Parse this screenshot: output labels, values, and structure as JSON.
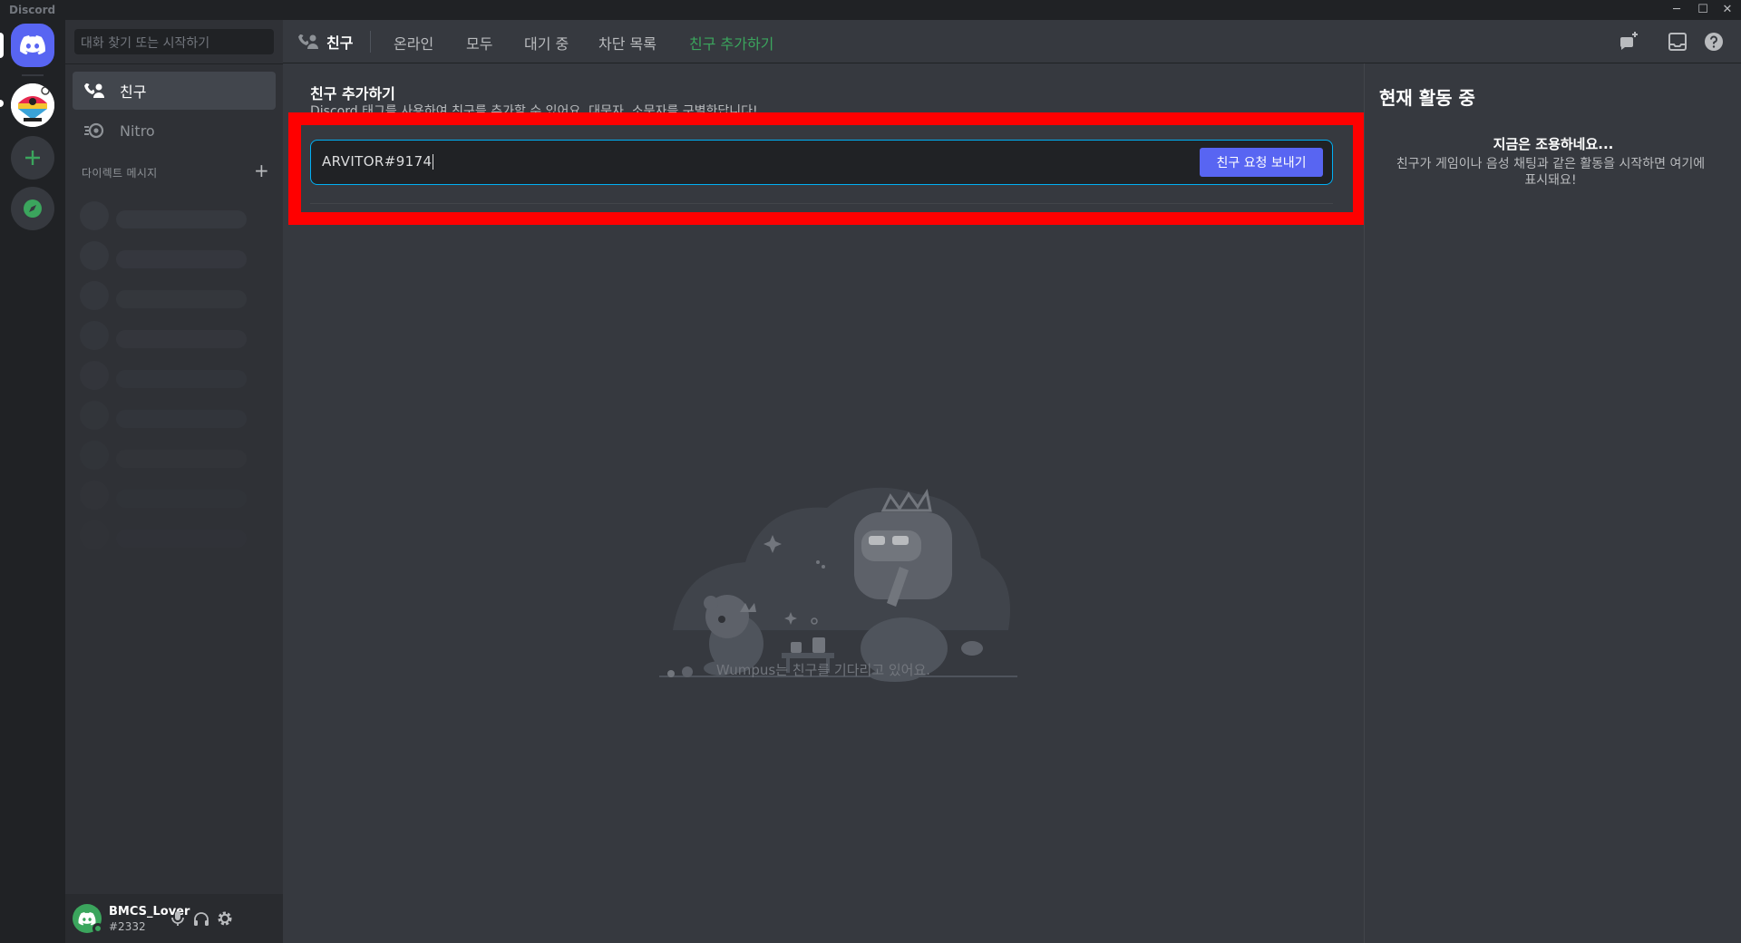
{
  "window": {
    "title": "Discord",
    "minimize": "─",
    "maximize": "☐",
    "close": "✕"
  },
  "sidebar": {
    "search_placeholder": "대화 찾기 또는 시작하기",
    "items": [
      {
        "label": "친구",
        "icon": "friends-icon",
        "active": true
      },
      {
        "label": "Nitro",
        "icon": "nitro-icon",
        "active": false
      }
    ],
    "dm_header": "다이렉트 메시지",
    "dm_add": "+"
  },
  "user": {
    "name": "BMCS_Lover",
    "tag": "#2332"
  },
  "header": {
    "title": "친구",
    "tabs": [
      {
        "label": "온라인"
      },
      {
        "label": "모두"
      },
      {
        "label": "대기 중"
      },
      {
        "label": "차단 목록"
      },
      {
        "label": "친구 추가하기"
      }
    ]
  },
  "add_friend": {
    "title": "친구 추가하기",
    "description": "Discord 태그를 사용하여 친구를 추가할 수 있어요. 대문자, 소문자를 구별한답니다!",
    "input_value": "ARVITOR#9174",
    "send_button": "친구 요청 보내기"
  },
  "empty_state": {
    "text": "Wumpus는 친구를 기다리고 있어요."
  },
  "active_now": {
    "title": "현재 활동 중",
    "quiet_title": "지금은 조용하네요...",
    "quiet_desc": "친구가 게임이나 음성 채팅과 같은 활동을 시작하면 여기에 표시돼요!"
  },
  "colors": {
    "accent": "#5865f2",
    "green": "#3ba55d",
    "highlight": "#ff0000"
  }
}
